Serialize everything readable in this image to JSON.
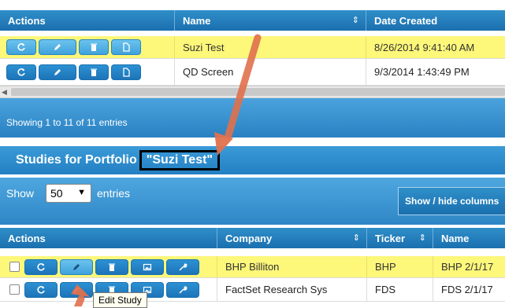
{
  "colors": {
    "header_blue": "#1b6fae",
    "highlight_yellow": "#fdf77a",
    "annotation_arrow": "#e0714d"
  },
  "top_table": {
    "headers": {
      "actions": "Actions",
      "name": "Name",
      "date_created": "Date Created"
    },
    "sort_glyph": "⇕",
    "rows": [
      {
        "name": "Suzi Test",
        "date": "8/26/2014 9:41:40 AM",
        "highlighted": true
      },
      {
        "name": "QD Screen",
        "date": "9/3/2014 1:43:49 PM",
        "highlighted": false
      }
    ],
    "info": "Showing 1 to 11 of 11 entries"
  },
  "portfolio_section": {
    "title_prefix": "Studies for Portfolio",
    "portfolio_name": "\"Suzi Test\""
  },
  "controls": {
    "show_label": "Show",
    "page_size": "50",
    "entries_label": "entries",
    "column_visibility": "Show / hide columns"
  },
  "bottom_table": {
    "headers": {
      "actions": "Actions",
      "company": "Company",
      "ticker": "Ticker",
      "name": "Name"
    },
    "rows": [
      {
        "company": "BHP Billiton",
        "ticker": "BHP",
        "name": "BHP 2/1/17",
        "highlighted": true
      },
      {
        "company": "FactSet Research Sys",
        "ticker": "FDS",
        "name": "FDS 2/1/17",
        "highlighted": false
      }
    ]
  },
  "tooltip": "Edit Study",
  "icons": {
    "rerun": "refresh-icon",
    "edit": "pencil-icon",
    "delete": "trash-icon",
    "document": "document-icon",
    "chart": "image-icon",
    "settings": "wrench-icon"
  }
}
